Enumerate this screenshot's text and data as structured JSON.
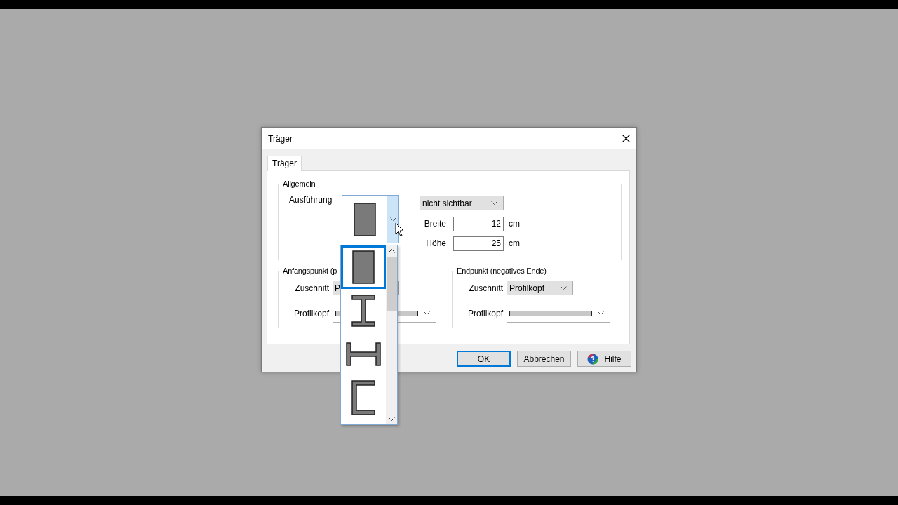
{
  "window": {
    "title": "Träger"
  },
  "tabs": [
    {
      "label": "Träger",
      "selected": true
    }
  ],
  "general": {
    "title": "Allgemein",
    "design_label": "Ausführung",
    "design": {
      "kind": "rect",
      "open": true
    },
    "visibility": "nicht sichtbar",
    "fields": [
      {
        "label": "Breite",
        "value": "12",
        "unit": "cm"
      },
      {
        "label": "Höhe",
        "value": "25",
        "unit": "cm"
      }
    ]
  },
  "design_options": [
    {
      "kind": "rect",
      "selected": true
    },
    {
      "kind": "i",
      "selected": false
    },
    {
      "kind": "h",
      "selected": false
    },
    {
      "kind": "c",
      "selected": false
    }
  ],
  "start": {
    "title": "Anfangspunkt (p",
    "cut_label": "Zuschnitt",
    "cut_value": "P",
    "head_label": "Profilkopf"
  },
  "end": {
    "title": "Endpunkt (negatives Ende)",
    "cut_label": "Zuschnitt",
    "cut_value": "Profilkopf",
    "head_label": "Profilkopf"
  },
  "buttons": [
    {
      "label": "OK",
      "kind": "default"
    },
    {
      "label": "Abbrechen",
      "kind": "plain"
    },
    {
      "label": "Hilfe",
      "kind": "help"
    }
  ]
}
